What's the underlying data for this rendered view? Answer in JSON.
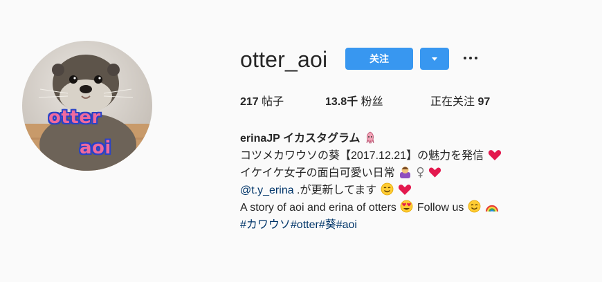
{
  "profile": {
    "username": "otter_aoi",
    "avatar_text_line1": "otter",
    "avatar_text_line2": "aoi"
  },
  "actions": {
    "follow_label": "关注",
    "dropdown_icon": "caret-down-icon",
    "more_icon": "more-horizontal-icon"
  },
  "stats": {
    "posts_count": "217",
    "posts_label": "帖子",
    "followers_count": "13.8千",
    "followers_label": "粉丝",
    "following_label": "正在关注",
    "following_count": "97"
  },
  "bio": {
    "name": "erinaJP イカスタグラム",
    "line1": "コツメカワウソの葵【2017.12.21】の魅力を発信",
    "line2": "イケイケ女子の面白可愛い日常",
    "line3_mention": "@t.y_erina",
    "line3_text": " .が更新してます",
    "line4_part1": "A story of aoi and erina of otters",
    "line4_part2": " Follow us",
    "hashtags": "#カワウソ#otter#葵#aoi"
  },
  "colors": {
    "primary_blue": "#3897f0",
    "text": "#262626",
    "link": "#003569",
    "background": "#fafafa"
  },
  "icons": [
    "squid-icon",
    "heart-icon",
    "woman-gesture-icon",
    "female-sign-icon",
    "smile-icon",
    "heart-eyes-icon",
    "rainbow-icon"
  ]
}
